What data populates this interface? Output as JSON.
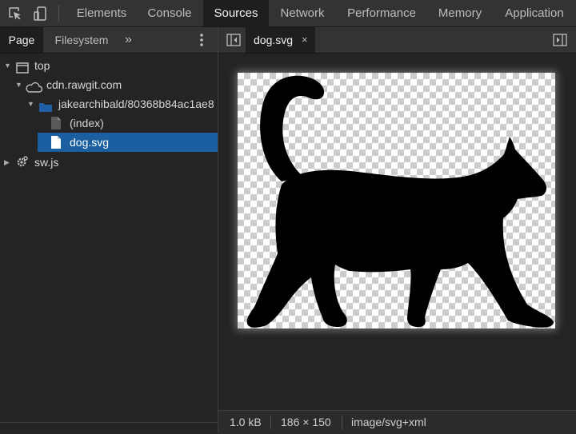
{
  "toolbar": {
    "tabs": [
      {
        "label": "Elements",
        "active": false
      },
      {
        "label": "Console",
        "active": false
      },
      {
        "label": "Sources",
        "active": true
      },
      {
        "label": "Network",
        "active": false
      },
      {
        "label": "Performance",
        "active": false
      },
      {
        "label": "Memory",
        "active": false
      },
      {
        "label": "Application",
        "active": false
      }
    ],
    "icons": [
      "inspect-element-icon",
      "device-toolbar-icon"
    ]
  },
  "sidebar": {
    "tabs": [
      {
        "label": "Page",
        "active": true
      },
      {
        "label": "Filesystem",
        "active": false
      }
    ],
    "more": "»",
    "tree": [
      {
        "label": "top",
        "icon": "frame-icon",
        "expanded": true
      },
      {
        "label": "cdn.rawgit.com",
        "icon": "cloud-icon",
        "expanded": true
      },
      {
        "label": "jakearchibald/80368b84ac1ae8",
        "icon": "folder-icon",
        "expanded": true
      },
      {
        "label": "(index)",
        "icon": "document-icon"
      },
      {
        "label": "dog.svg",
        "icon": "document-icon",
        "selected": true
      },
      {
        "label": "sw.js",
        "icon": "service-worker-gear-icon",
        "expanded": false
      }
    ]
  },
  "editor": {
    "open_tab": {
      "label": "dog.svg",
      "close": "×"
    },
    "preview_image": "black-cat-silhouette-on-transparent-checkerboard"
  },
  "status": {
    "size": "1.0 kB",
    "dimensions": "186 × 150",
    "mime": "image/svg+xml"
  },
  "colors": {
    "selection": "#1a5fa0",
    "folder": "#1e5fa8",
    "toolbar_bg": "#333333",
    "panel_bg": "#242424",
    "active_tab_bg": "#1e1e1e"
  }
}
